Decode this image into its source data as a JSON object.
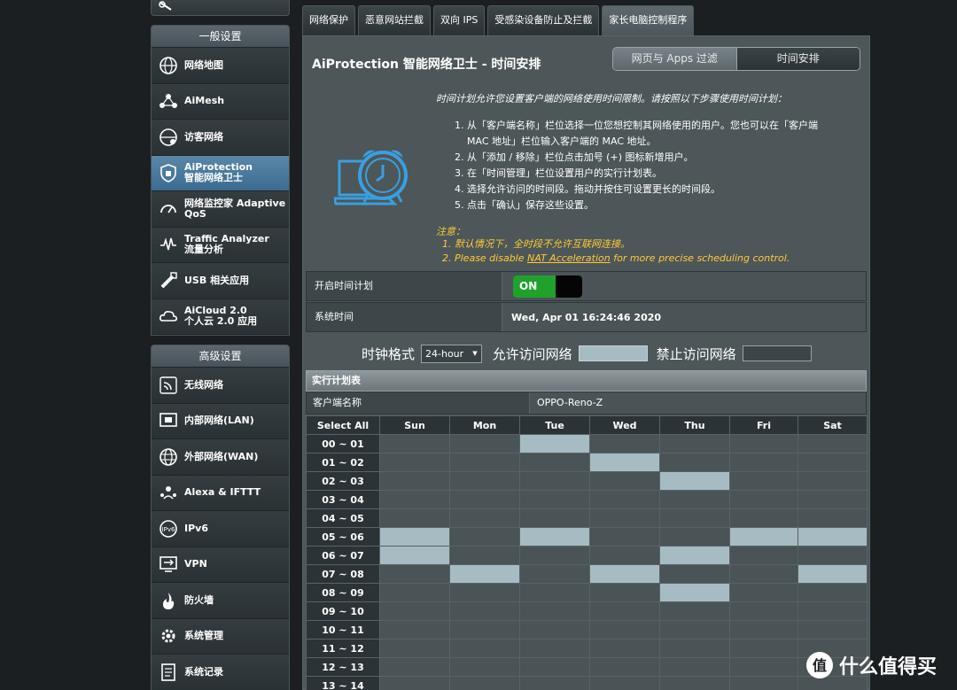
{
  "sidebar": {
    "general_header": "一般设置",
    "general_items": [
      {
        "label": "网络地图",
        "icon": "globe-icon"
      },
      {
        "label": "AiMesh",
        "icon": "mesh-icon"
      },
      {
        "label": "访客网络",
        "icon": "guest-globe-icon"
      },
      {
        "label": "AiProtection\n智能网络卫士",
        "icon": "shield-icon",
        "active": true
      },
      {
        "label": "网络监控家 Adaptive\nQoS",
        "icon": "gauge-icon"
      },
      {
        "label": "Traffic Analyzer\n流量分析",
        "icon": "traffic-icon"
      },
      {
        "label": "USB 相关应用",
        "icon": "usb-icon"
      },
      {
        "label": "AiCloud 2.0\n个人云 2.0 应用",
        "icon": "cloud-icon"
      }
    ],
    "advanced_header": "高级设置",
    "advanced_items": [
      {
        "label": "无线网络",
        "icon": "wireless-icon"
      },
      {
        "label": "内部网络(LAN)",
        "icon": "lan-icon"
      },
      {
        "label": "外部网络(WAN)",
        "icon": "wan-globe-icon"
      },
      {
        "label": "Alexa & IFTTT",
        "icon": "alexa-icon"
      },
      {
        "label": "IPv6",
        "icon": "ipv6-icon"
      },
      {
        "label": "VPN",
        "icon": "vpn-icon"
      },
      {
        "label": "防火墙",
        "icon": "firewall-icon"
      },
      {
        "label": "系统管理",
        "icon": "admin-gear-icon"
      },
      {
        "label": "系统记录",
        "icon": "log-icon"
      }
    ]
  },
  "tabs": [
    "网络保护",
    "恶意网站拦截",
    "双向 IPS",
    "受感染设备防止及拦截",
    "家长电脑控制程序"
  ],
  "active_tab": 4,
  "page": {
    "title": "AiProtection 智能网络卫士 - 时间安排",
    "seg_left": "网页与 Apps 过滤",
    "seg_right": "时间安排",
    "intro": "时间计划允许您设置客户端的网络使用时间限制。请按照以下步骤使用时间计划：",
    "steps": [
      "1. 从「客户端名称」栏位选择一位您想控制其网络使用的用户。您也可以在「客户端",
      "MAC 地址」栏位输入客户端的 MAC 地址。",
      "2. 从「添加 / 移除」栏位点击加号 (+) 图标新增用户。",
      "3. 在「时间管理」栏位设置用户的实行计划表。",
      "4. 选择允许访问的时间段。拖动并按住可设置更长的时间段。",
      "5. 点击「确认」保存这些设置。"
    ],
    "note_title": "注意：",
    "note1": "1. 默认情况下，全时段不允许互联网连接。",
    "note2_prefix": "2. Please disable ",
    "note2_link": "NAT Acceleration",
    "note2_suffix": " for more precise scheduling control."
  },
  "form": {
    "schedule_label": "开启时间计划",
    "toggle_label": "ON",
    "system_time_label": "系统时间",
    "system_time_value": "Wed, Apr 01 16:24:46 2020"
  },
  "legend": {
    "clock_format_label": "时钟格式",
    "clock_format_value": "24-hour",
    "allow_label": "允许访问网络",
    "deny_label": "禁止访问网络"
  },
  "schedule": {
    "header": "实行计划表",
    "client_label": "客户端名称",
    "client_value": "OPPO-Reno-Z",
    "select_all": "Select All",
    "days": [
      "Sun",
      "Mon",
      "Tue",
      "Wed",
      "Thu",
      "Fri",
      "Sat"
    ],
    "rows": [
      {
        "hour": "00 ~ 01",
        "allowed": [
          0,
          0,
          1,
          0,
          0,
          0,
          0
        ]
      },
      {
        "hour": "01 ~ 02",
        "allowed": [
          0,
          0,
          0,
          1,
          0,
          0,
          0
        ]
      },
      {
        "hour": "02 ~ 03",
        "allowed": [
          0,
          0,
          0,
          0,
          1,
          0,
          0
        ]
      },
      {
        "hour": "03 ~ 04",
        "allowed": [
          0,
          0,
          0,
          0,
          0,
          0,
          0
        ]
      },
      {
        "hour": "04 ~ 05",
        "allowed": [
          0,
          0,
          0,
          0,
          0,
          0,
          0
        ]
      },
      {
        "hour": "05 ~ 06",
        "allowed": [
          1,
          0,
          1,
          0,
          0,
          1,
          1
        ]
      },
      {
        "hour": "06 ~ 07",
        "allowed": [
          1,
          0,
          0,
          0,
          1,
          0,
          0
        ]
      },
      {
        "hour": "07 ~ 08",
        "allowed": [
          0,
          1,
          0,
          1,
          0,
          0,
          1
        ]
      },
      {
        "hour": "08 ~ 09",
        "allowed": [
          0,
          0,
          0,
          0,
          1,
          0,
          0
        ]
      },
      {
        "hour": "09 ~ 10",
        "allowed": [
          0,
          0,
          0,
          0,
          0,
          0,
          0
        ]
      },
      {
        "hour": "10 ~ 11",
        "allowed": [
          0,
          0,
          0,
          0,
          0,
          0,
          0
        ]
      },
      {
        "hour": "11 ~ 12",
        "allowed": [
          0,
          0,
          0,
          0,
          0,
          0,
          0
        ]
      },
      {
        "hour": "12 ~ 13",
        "allowed": [
          0,
          0,
          0,
          0,
          0,
          0,
          0
        ]
      },
      {
        "hour": "13 ~ 14",
        "allowed": [
          0,
          0,
          0,
          0,
          0,
          0,
          0
        ]
      }
    ]
  },
  "watermark": {
    "text": "什么值得买",
    "logo": "值"
  }
}
